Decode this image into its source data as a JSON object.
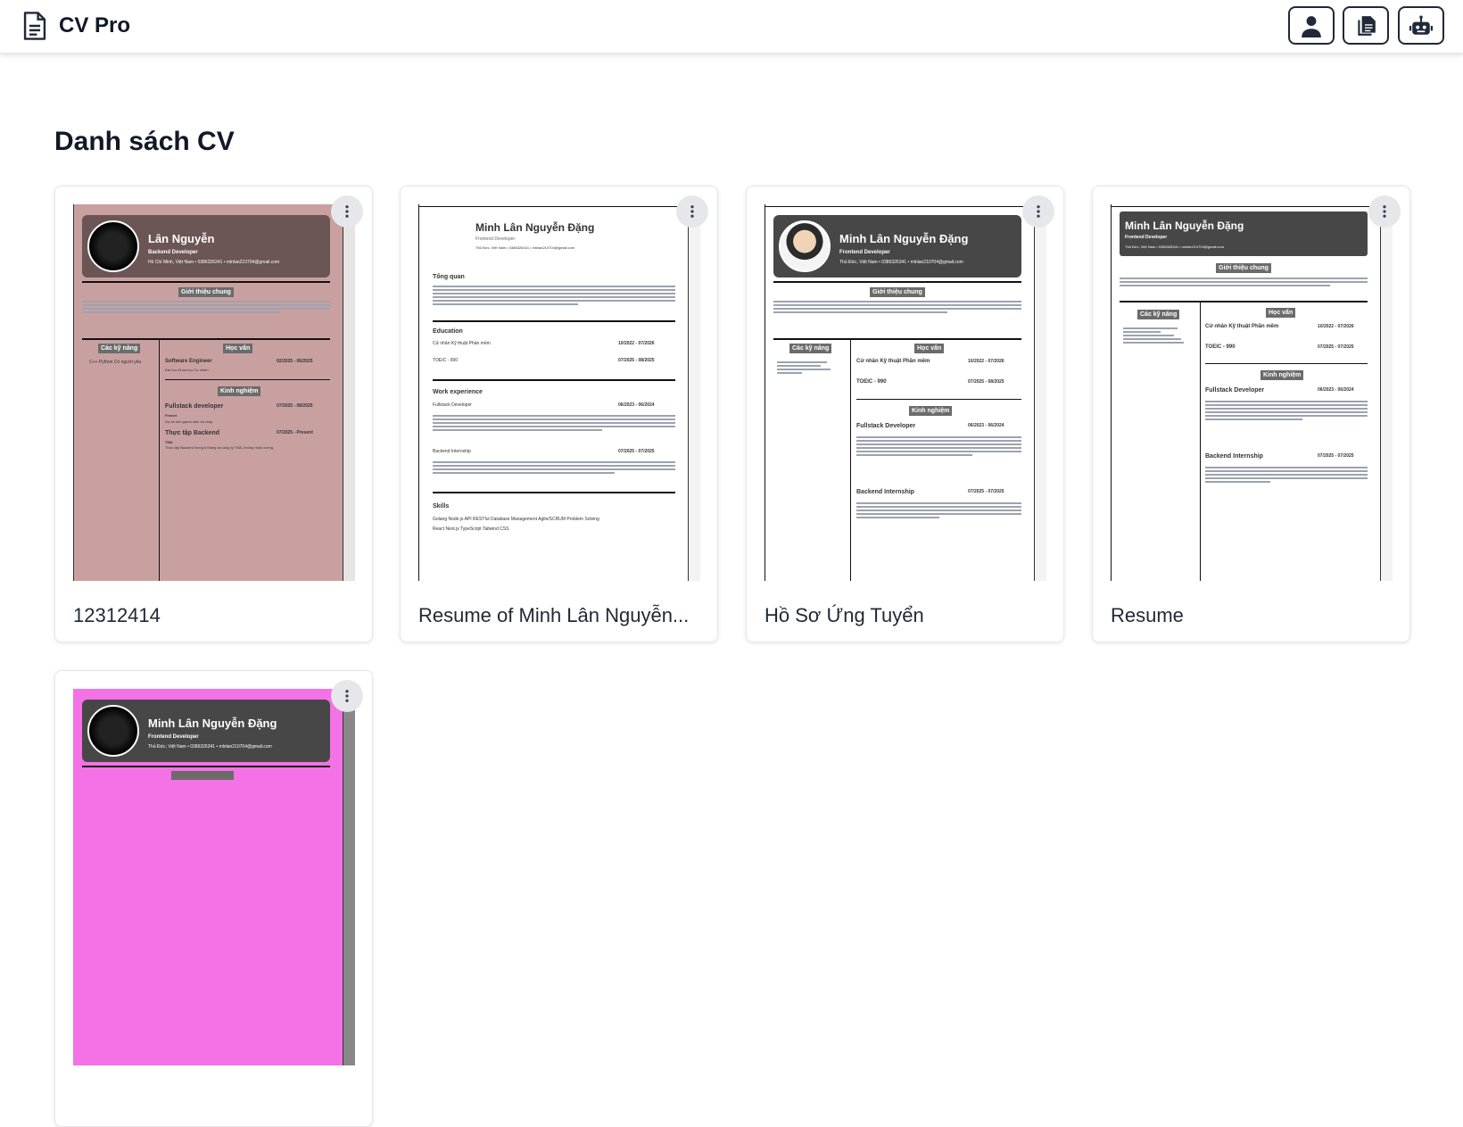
{
  "app": {
    "title": "CV Pro"
  },
  "page": {
    "title": "Danh sách CV"
  },
  "colors": {
    "card1_bg": "#c9a0a0",
    "card5_bg": "#f472e6",
    "dark_header": "#474747"
  },
  "icons": [
    "file-icon",
    "user-icon",
    "copy-icon",
    "robot-icon",
    "more-vertical-icon"
  ],
  "cards": [
    {
      "name": "12312414",
      "preview": {
        "person": "Lân Nguyễn",
        "role": "Backend Developer",
        "contact": "Hồ Chí Minh, Việt Nam • 0386326341 • mlnlan210704@gmail.com",
        "sec_intro": "Giới thiệu chung",
        "sec_skills": "Các kỹ năng",
        "sec_edu": "Học vấn",
        "sec_exp": "Kinh nghiệm",
        "skills": "C++   Python   Có người yêu",
        "edu1": "Software Engineer",
        "edu1_date": "02/2025 - 06/2025",
        "edu1_sub": "Đại học Khoa học Tự nhiên",
        "exp1": "Fullstack developer",
        "exp1_date": "07/2025 - 08/2025",
        "exp1_co": "Fennet",
        "exp1_desc": "Dự án làm game siêu bá cháy",
        "exp2": "Thực tập Backend",
        "exp2_date": "07/2025 - Present",
        "exp2_co": "TMA",
        "exp2_desc": "Thực tập Backend trong 6 tháng tại công ty TMA, không nhận lương."
      }
    },
    {
      "name": "Resume of Minh Lân Nguyễn...",
      "preview": {
        "person": "Minh Lân Nguyễn Đặng",
        "role": "Frontend Developer",
        "contact": "Thủ Đức, Việt Nam • 0386326341 • mlnlan210704@gmail.com",
        "sec_summary": "Tổng quan",
        "sec_edu": "Education",
        "sec_exp": "Work experience",
        "sec_skills": "Skills",
        "edu1": "Cử nhân Kỹ thuật Phần mềm",
        "edu1_date": "10/2022 - 07/2026",
        "edu2": "TOEIC - 990",
        "edu2_date": "07/2025 - 08/2025",
        "exp1": "Fullstack Developer",
        "exp1_date": "06/2023 - 06/2024",
        "exp2": "Backend Internship",
        "exp2_date": "07/2025 - 07/2025",
        "skills1": "Golang  Node.js  API RESTful  Database Management  Agile/SCRUM  Problem Solving",
        "skills2": "React  Next.js  TypeScript  Tailwind CSS"
      }
    },
    {
      "name": "Hồ Sơ Ứng Tuyển",
      "preview": {
        "person": "Minh Lân Nguyễn Đặng",
        "role": "Frontend Developer",
        "contact": "Thủ Đức, Việt Nam • 0386326341 • mlnlan210704@gmail.com",
        "sec_intro": "Giới thiệu chung",
        "sec_skills": "Các kỹ năng",
        "sec_edu": "Học vấn",
        "sec_exp": "Kinh nghiệm",
        "edu1": "Cử nhân Kỹ thuật Phần mềm",
        "edu1_date": "10/2022 - 07/2026",
        "edu2": "TOEIC - 990",
        "edu2_date": "07/2025 - 08/2025",
        "exp1": "Fullstack Developer",
        "exp1_date": "06/2023 - 06/2024",
        "exp2": "Backend Internship",
        "exp2_date": "07/2025 - 07/2025"
      }
    },
    {
      "name": "Resume",
      "preview": {
        "person": "Minh Lân Nguyễn Đặng",
        "role": "Frontend Developer",
        "contact": "Thủ Đức, Việt Nam • 0386326341 • mlnlan210704@gmail.com",
        "sec_intro": "Giới thiệu chung",
        "sec_skills": "Các kỹ năng",
        "sec_edu": "Học vấn",
        "sec_exp": "Kinh nghiệm",
        "edu1": "Cử nhân Kỹ thuật Phần mềm",
        "edu1_date": "10/2022 - 07/2026",
        "edu2": "TOEIC - 990",
        "edu2_date": "07/2025 - 07/2025",
        "exp1": "Fullstack Developer",
        "exp1_date": "06/2023 - 06/2024",
        "exp2": "Backend Internship",
        "exp2_date": "07/2025 - 07/2025"
      }
    },
    {
      "name": "",
      "preview": {
        "person": "Minh Lân Nguyễn Đặng",
        "role": "Frontend Developer",
        "contact": "Thủ Đức, Việt Nam • 0386326341 • mlnlan210704@gmail.com"
      }
    }
  ]
}
